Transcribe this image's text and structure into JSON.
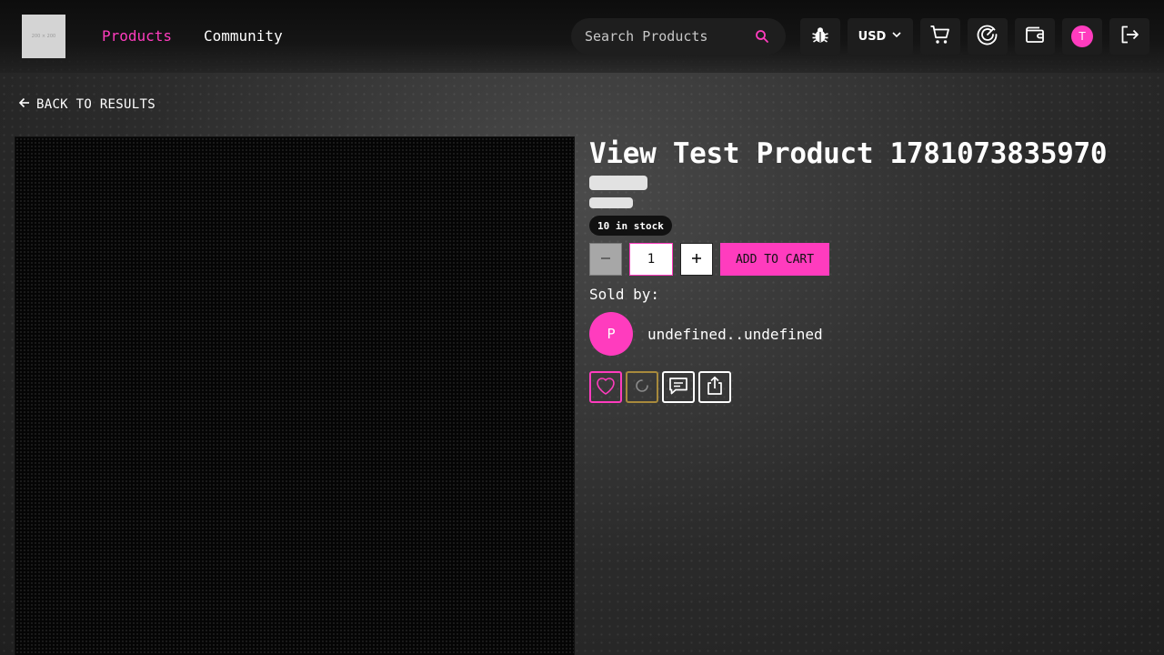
{
  "header": {
    "logo_text": "200 × 200",
    "nav": [
      {
        "label": "Products",
        "active": true
      },
      {
        "label": "Community",
        "active": false
      }
    ],
    "search": {
      "placeholder": "Search Products",
      "value": ""
    },
    "currency": "USD",
    "user_initial": "T",
    "icons": [
      "bug-icon",
      "cart-icon",
      "dashboard-gauge-icon",
      "wallet-icon",
      "logout-icon"
    ]
  },
  "back_label": "BACK TO RESULTS",
  "product": {
    "title": "View Test Product 1781073835970",
    "stock_badge": "10 in stock",
    "quantity": "1",
    "add_to_cart_label": "ADD TO CART",
    "sold_by_label": "Sold by:",
    "seller_initial": "P",
    "seller_name": "undefined..undefined"
  },
  "colors": {
    "accent": "#ff3cbe",
    "loading_border": "#a88a3c",
    "header_bg": "#111111"
  }
}
